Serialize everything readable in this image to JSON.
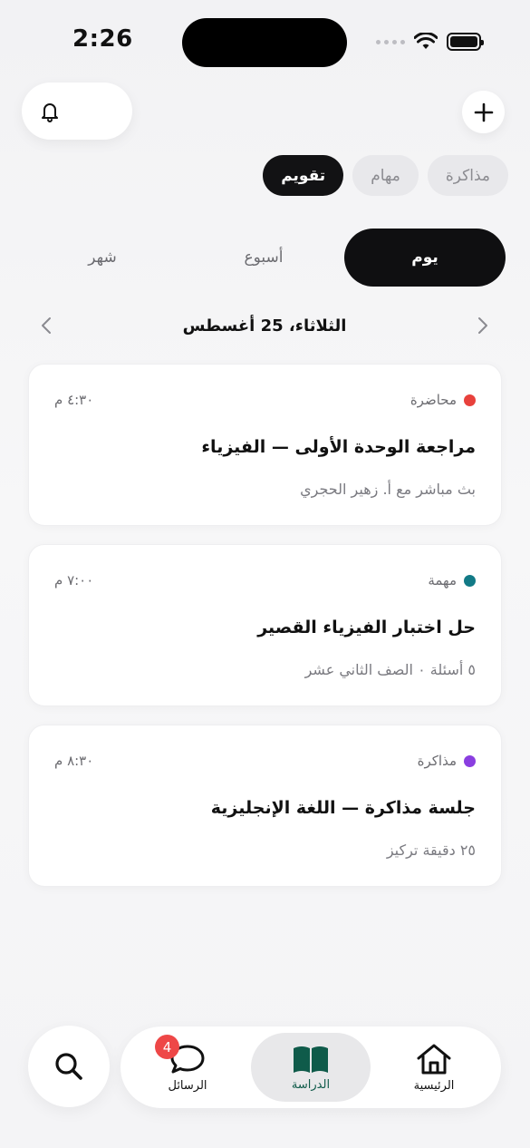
{
  "status_bar": {
    "time": "2:26"
  },
  "top_chips": [
    {
      "label": "مذاكرة",
      "active": false
    },
    {
      "label": "مهام",
      "active": false
    },
    {
      "label": "تقويم",
      "active": true
    }
  ],
  "view_tabs": [
    {
      "label": "يوم",
      "active": true
    },
    {
      "label": "أسبوع",
      "active": false
    },
    {
      "label": "شهر",
      "active": false
    }
  ],
  "date_nav": {
    "label": "الثلاثاء، 25 أغسطس"
  },
  "events": [
    {
      "time": "٤:٣٠ م",
      "type": "محاضرة",
      "type_color": "#e8413c",
      "title": "مراجعة الوحدة الأولى — الفيزياء",
      "subtitle": "بث مباشر مع أ. زهير الحجري"
    },
    {
      "time": "٧:٠٠ م",
      "type": "مهمة",
      "type_color": "#127a86",
      "title": "حل اختبار الفيزياء القصير",
      "subtitle": "٥ أسئلة ٠ الصف الثاني عشر"
    },
    {
      "time": "٨:٣٠ م",
      "type": "مذاكرة",
      "type_color": "#8a3ee0",
      "title": "جلسة مذاكرة — اللغة الإنجليزية",
      "subtitle": "٢٥ دقيقة تركيز"
    }
  ],
  "tabbar": {
    "home_label": "الرئيسية",
    "study_label": "الدراسة",
    "messages_label": "الرسائل",
    "messages_badge": "4"
  },
  "icons": {
    "bell": "bell-icon",
    "plus": "plus-icon",
    "search": "search-icon",
    "home": "home-icon",
    "book": "book-icon",
    "chat": "chat-bubble-icon"
  },
  "colors": {
    "accent_dark": "#0f0f11",
    "study_green": "#0f5b4a",
    "badge_red": "#ee4747"
  }
}
